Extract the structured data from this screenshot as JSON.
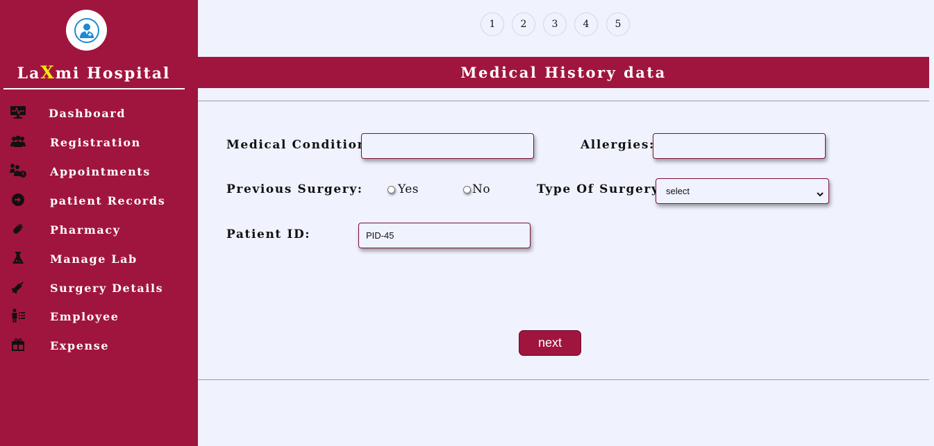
{
  "brand": {
    "prefix": "La",
    "accent": "X",
    "suffix": "mi Hospital",
    "accent_color": "#f5e80b"
  },
  "sidebar": {
    "items": [
      {
        "label": "Dashboard",
        "icon": "monitor-icon"
      },
      {
        "label": "Registration",
        "icon": "users-icon"
      },
      {
        "label": "Appointments",
        "icon": "user-clock-icon"
      },
      {
        "label": "patient Records",
        "icon": "sign-in-icon"
      },
      {
        "label": "Pharmacy",
        "icon": "pill-icon"
      },
      {
        "label": "Manage Lab",
        "icon": "flask-icon"
      },
      {
        "label": "Surgery Details",
        "icon": "syringe-icon"
      },
      {
        "label": "Employee",
        "icon": "employee-list-icon"
      },
      {
        "label": "Expense",
        "icon": "gift-icon"
      }
    ]
  },
  "steps": [
    "1",
    "2",
    "3",
    "4",
    "5"
  ],
  "header": {
    "title": "Medical History data"
  },
  "form": {
    "medical_condition": {
      "label": "Medical Condition:",
      "value": ""
    },
    "allergies": {
      "label": "Allergies:",
      "value": ""
    },
    "previous_surgery": {
      "label": "Previous Surgery:",
      "yes_label": "Yes",
      "no_label": "No"
    },
    "type_of_surgery": {
      "label": "Type Of Surgery:",
      "selected": "select"
    },
    "patient_id": {
      "label": "Patient ID:",
      "value": "PID-45"
    }
  },
  "actions": {
    "next_label": "next"
  },
  "colors": {
    "primary": "#a0153e",
    "background": "#f0f2fd"
  }
}
